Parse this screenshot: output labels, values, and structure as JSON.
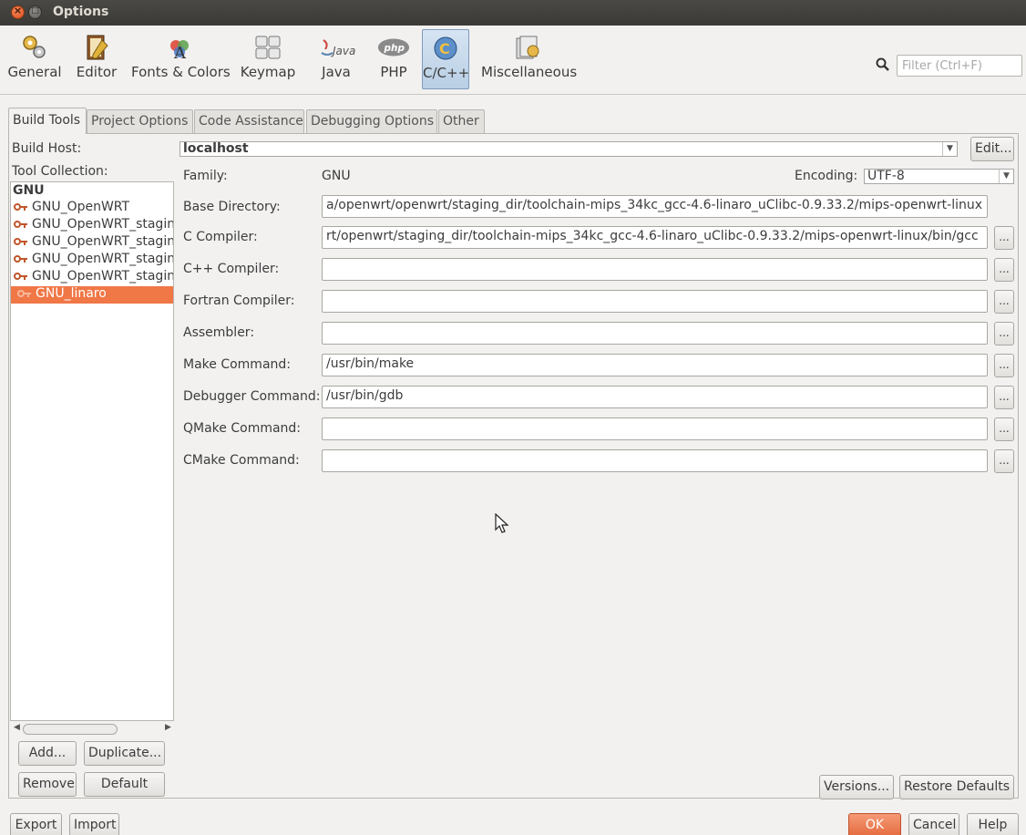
{
  "window": {
    "title": "Options"
  },
  "toolbar": {
    "categories": [
      {
        "label": "General",
        "icon": "gears-icon"
      },
      {
        "label": "Editor",
        "icon": "editor-icon"
      },
      {
        "label": "Fonts & Colors",
        "icon": "fonts-colors-icon"
      },
      {
        "label": "Keymap",
        "icon": "keymap-icon"
      },
      {
        "label": "Java",
        "icon": "java-icon"
      },
      {
        "label": "PHP",
        "icon": "php-icon"
      },
      {
        "label": "C/C++",
        "icon": "cpp-icon"
      },
      {
        "label": "Miscellaneous",
        "icon": "miscellaneous-icon"
      }
    ],
    "active": "C/C++",
    "filter_placeholder": "Filter (Ctrl+F)"
  },
  "tabs": [
    "Build Tools",
    "Project Options",
    "Code Assistance",
    "Debugging Options",
    "Other"
  ],
  "active_tab": "Build Tools",
  "build_host": {
    "label": "Build Host:",
    "value": "localhost",
    "edit_label": "Edit..."
  },
  "tool_collection": {
    "label": "Tool Collection:",
    "header": "GNU",
    "items": [
      "GNU_OpenWRT",
      "GNU_OpenWRT_stagin",
      "GNU_OpenWRT_stagin",
      "GNU_OpenWRT_stagin",
      "GNU_OpenWRT_stagin",
      "GNU_linaro"
    ],
    "selected": "GNU_linaro"
  },
  "left_buttons": {
    "add": "Add...",
    "duplicate": "Duplicate...",
    "remove": "Remove",
    "default": "Default"
  },
  "family": {
    "label": "Family:",
    "value": "GNU"
  },
  "encoding": {
    "label": "Encoding:",
    "value": "UTF-8"
  },
  "fields": [
    {
      "label": "Base Directory:",
      "value": "a/openwrt/openwrt/staging_dir/toolchain-mips_34kc_gcc-4.6-linaro_uClibc-0.9.33.2/mips-openwrt-linux"
    },
    {
      "label": "C Compiler:",
      "value": "rt/openwrt/staging_dir/toolchain-mips_34kc_gcc-4.6-linaro_uClibc-0.9.33.2/mips-openwrt-linux/bin/gcc"
    },
    {
      "label": "C++ Compiler:",
      "value": ""
    },
    {
      "label": "Fortran Compiler:",
      "value": ""
    },
    {
      "label": "Assembler:",
      "value": ""
    },
    {
      "label": "Make Command:",
      "value": "/usr/bin/make"
    },
    {
      "label": "Debugger Command:",
      "value": "/usr/bin/gdb"
    },
    {
      "label": "QMake Command:",
      "value": ""
    },
    {
      "label": "CMake Command:",
      "value": ""
    }
  ],
  "browse_label": "...",
  "panel_buttons": {
    "versions": "Versions...",
    "restore": "Restore Defaults"
  },
  "footer": {
    "export": "Export",
    "import": "Import",
    "ok": "OK",
    "cancel": "Cancel",
    "help": "Help"
  },
  "colors": {
    "accent": "#f07746",
    "active_tab_bg": "#c8d9ec",
    "titlebar": "#3c3b37"
  }
}
